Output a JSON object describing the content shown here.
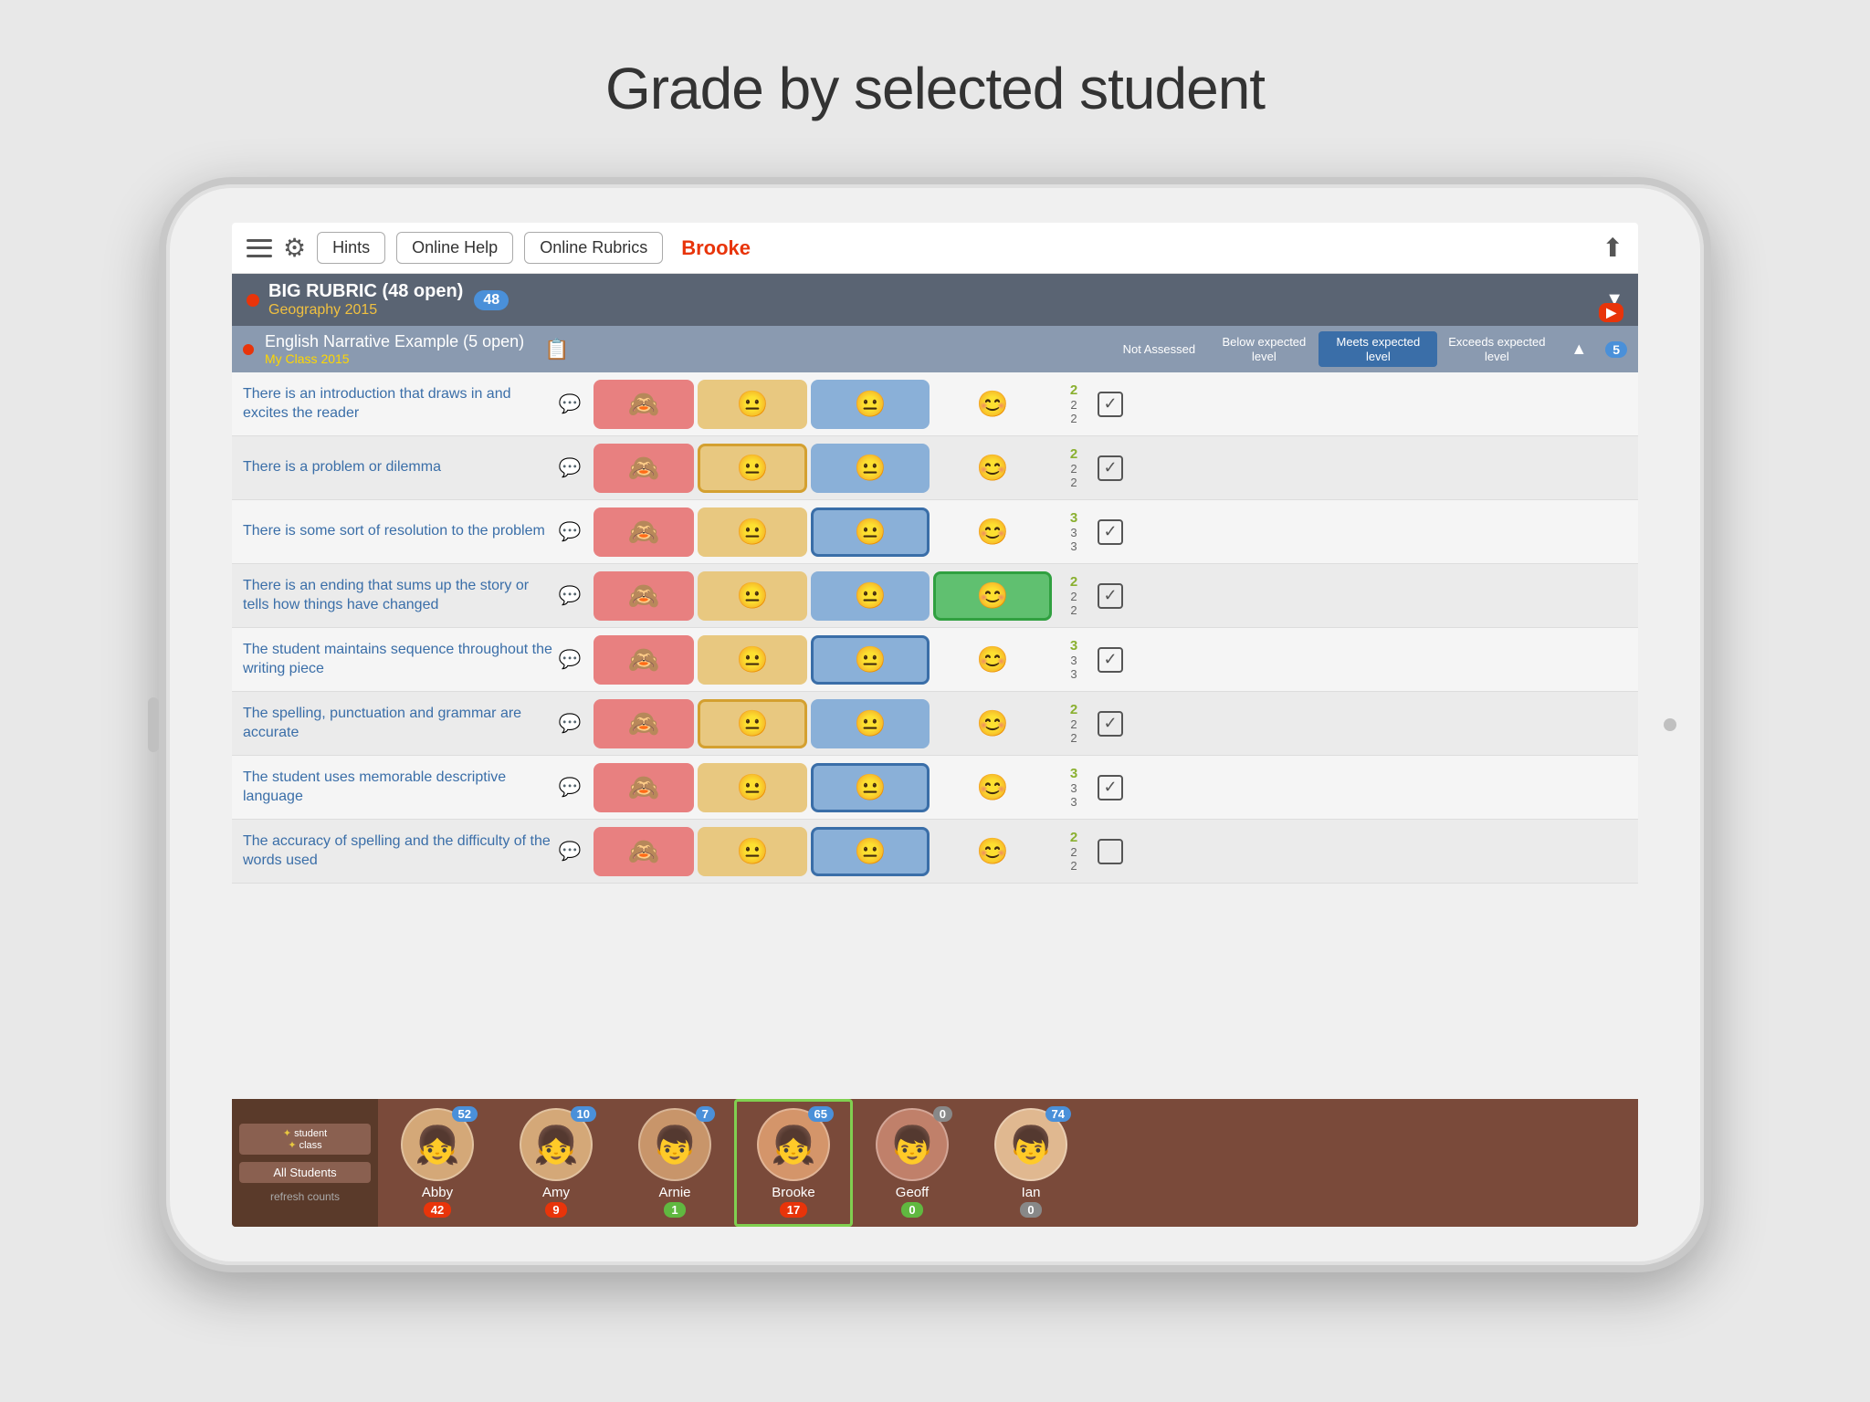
{
  "page": {
    "title": "Grade by selected student"
  },
  "topbar": {
    "hints_label": "Hints",
    "online_help_label": "Online Help",
    "online_rubrics_label": "Online Rubrics",
    "student_name": "Brooke"
  },
  "big_rubric": {
    "title": "BIG RUBRIC (48 open)",
    "subtitle": "Geography 2015",
    "badge": "48",
    "badge_red": "▶"
  },
  "sub_rubric": {
    "title": "English Narrative Example (5 open)",
    "class": "My Class 2015",
    "badge": "5",
    "columns": {
      "not_assessed": "Not Assessed",
      "below": "Below expected level",
      "meets": "Meets expected level",
      "exceeds": "Exceeds expected level"
    }
  },
  "criteria": [
    {
      "text": "There is an introduction that draws in and excites the reader",
      "selected": "not_assessed",
      "score": "2/2/2",
      "checked": true
    },
    {
      "text": "There is a problem or dilemma",
      "selected": "below",
      "score": "2/2/2",
      "checked": true
    },
    {
      "text": "There is some sort of resolution to the problem",
      "selected": "meets",
      "score": "3/3/3",
      "checked": true
    },
    {
      "text": "There is an ending that sums up the story or tells how things have changed",
      "selected": "exceeds",
      "score": "2/2/2",
      "checked": true
    },
    {
      "text": "The student maintains sequence throughout the writing piece",
      "selected": "meets",
      "score": "3/3/3",
      "checked": true
    },
    {
      "text": "The spelling, punctuation and grammar are accurate",
      "selected": "below",
      "score": "2/2/2",
      "checked": true
    },
    {
      "text": "The student uses memorable descriptive language",
      "selected": "meets",
      "score": "3/3/3",
      "checked": true
    },
    {
      "text": "The accuracy of spelling and the difficulty of the words used",
      "selected": "meets",
      "score": "2/2/2",
      "checked": false
    }
  ],
  "students": [
    {
      "name": "All Students",
      "is_toggle": true
    },
    {
      "name": "Abby",
      "top_score": "52",
      "bottom_score": "42",
      "bottom_color": "red",
      "avatar_color": "#d4956a",
      "emoji": "👧"
    },
    {
      "name": "Amy",
      "top_score": "10",
      "bottom_score": "9",
      "bottom_color": "red",
      "avatar_color": "#d4956a",
      "emoji": "👧"
    },
    {
      "name": "Arnie",
      "top_score": "7",
      "bottom_score": "1",
      "bottom_color": "green",
      "avatar_color": "#a0785a",
      "emoji": "👦"
    },
    {
      "name": "Brooke",
      "top_score": "65",
      "bottom_score": "17",
      "bottom_color": "red",
      "avatar_color": "#c8956a",
      "emoji": "👧",
      "selected": true
    },
    {
      "name": "Geoff",
      "top_score": "0",
      "bottom_score": "0",
      "bottom_color": "green",
      "avatar_color": "#a0785a",
      "emoji": "👦"
    },
    {
      "name": "Ian",
      "top_score": "74",
      "bottom_score": "0",
      "bottom_color": "gray",
      "avatar_color": "#d4a080",
      "emoji": "👦"
    }
  ],
  "student_tabs": {
    "student_label": "student",
    "class_label": "class",
    "all_students_label": "All Students",
    "refresh_label": "refresh counts"
  }
}
